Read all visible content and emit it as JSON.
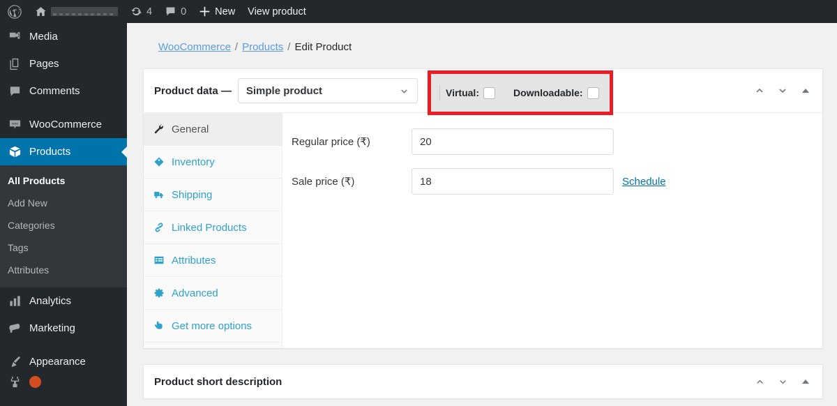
{
  "admin_bar": {
    "wp_logo_icon": "wordpress-logo-icon",
    "home_icon": "home-icon",
    "site_name": "",
    "updates_icon": "updates-icon",
    "updates_count": "4",
    "comments_icon": "comments-icon",
    "comments_count": "0",
    "new_icon": "plus-icon",
    "new_label": "New",
    "view_product_label": "View product"
  },
  "sidebar": {
    "items": [
      {
        "label": "Media",
        "icon": "media-icon",
        "current": false
      },
      {
        "label": "Pages",
        "icon": "pages-icon",
        "current": false
      },
      {
        "label": "Comments",
        "icon": "comments-icon",
        "current": false
      },
      {
        "label": "WooCommerce",
        "icon": "woocommerce-icon",
        "current": false
      },
      {
        "label": "Products",
        "icon": "products-box-icon",
        "current": true
      },
      {
        "label": "Analytics",
        "icon": "analytics-bars-icon",
        "current": false
      },
      {
        "label": "Marketing",
        "icon": "marketing-megaphone-icon",
        "current": false
      },
      {
        "label": "Appearance",
        "icon": "appearance-brush-icon",
        "current": false
      }
    ],
    "products_submenu": [
      {
        "label": "All Products",
        "current": true
      },
      {
        "label": "Add New",
        "current": false
      },
      {
        "label": "Categories",
        "current": false
      },
      {
        "label": "Tags",
        "current": false
      },
      {
        "label": "Attributes",
        "current": false
      }
    ]
  },
  "breadcrumb": {
    "first": "WooCommerce",
    "sep1": "/",
    "second": "Products",
    "sep2": "/",
    "current": "Edit Product"
  },
  "product_data": {
    "title": "Product data —",
    "product_type": "Simple product",
    "chevron_icon": "chevron-down-icon",
    "highlight_color": "#ed1c24",
    "virtual_label": "Virtual:",
    "virtual_checked": false,
    "downloadable_label": "Downloadable:",
    "downloadable_checked": false,
    "handle_up_icon": "chevron-up-icon",
    "handle_down_icon": "chevron-down-icon",
    "handle_toggle_icon": "triangle-up-icon",
    "tabs": [
      {
        "label": "General",
        "icon": "wrench-icon",
        "active": true
      },
      {
        "label": "Inventory",
        "icon": "tag-icon",
        "active": false
      },
      {
        "label": "Shipping",
        "icon": "truck-icon",
        "active": false
      },
      {
        "label": "Linked Products",
        "icon": "link-icon",
        "active": false
      },
      {
        "label": "Attributes",
        "icon": "list-table-icon",
        "active": false
      },
      {
        "label": "Advanced",
        "icon": "gear-icon",
        "active": false
      },
      {
        "label": "Get more options",
        "icon": "pointing-hand-icon",
        "active": false
      }
    ],
    "fields": [
      {
        "label": "Regular price (₹)",
        "value": "20",
        "link": ""
      },
      {
        "label": "Sale price (₹)",
        "value": "18",
        "link": "Schedule"
      }
    ]
  },
  "short_description": {
    "title": "Product short description",
    "handle_up_icon": "chevron-up-icon",
    "handle_down_icon": "chevron-down-icon",
    "handle_toggle_icon": "triangle-up-icon"
  },
  "colors": {
    "wp_blue": "#0073aa",
    "sidebar_bg": "#23282d",
    "submenu_bg": "#32373c",
    "link_blue": "#2ea2cc",
    "annotation_red": "#ed1c24",
    "page_bg": "#f1f1f1"
  }
}
